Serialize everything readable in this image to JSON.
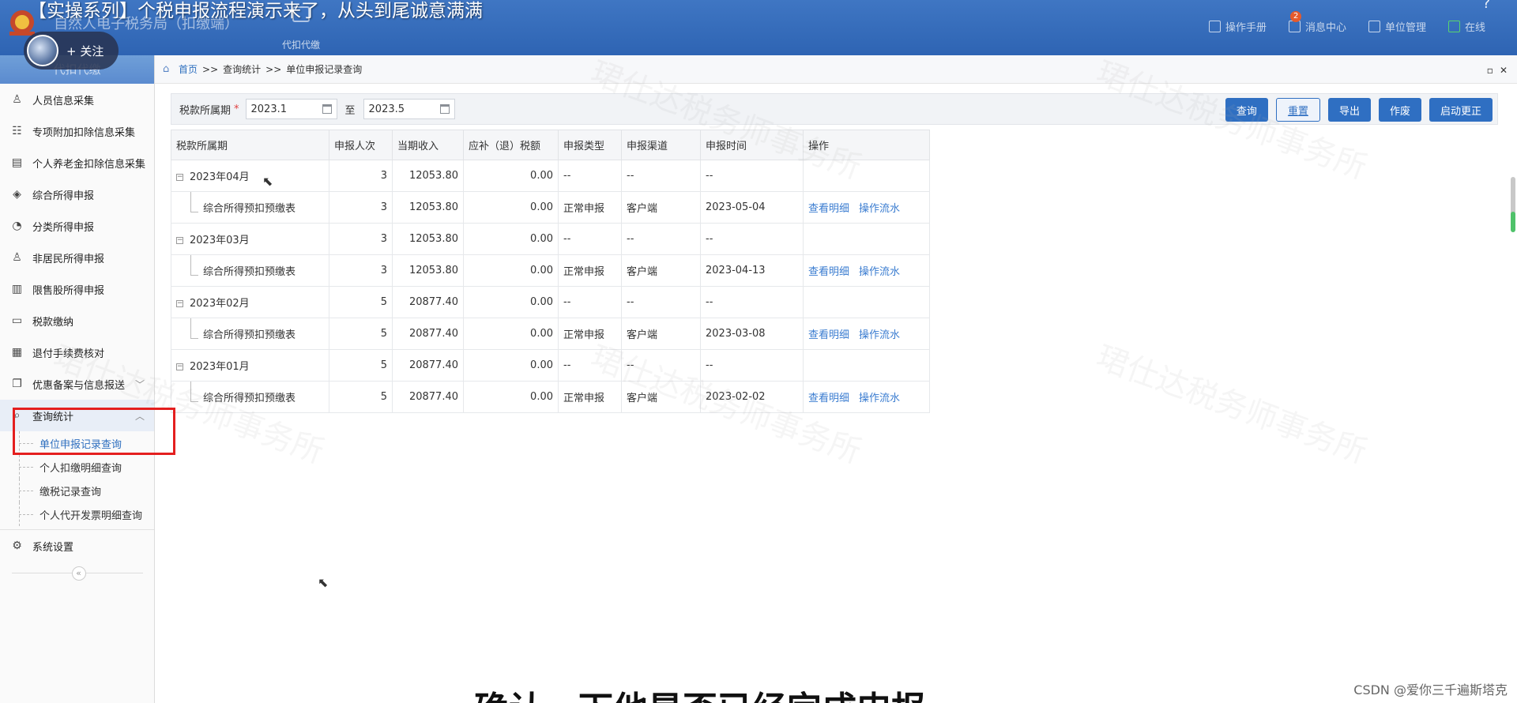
{
  "video": {
    "title": "【实操系列】个税申报流程演示来了，从头到尾诚意满满",
    "follow_label": "+ 关注",
    "subtitle": "确认一下他是否已经完成申报",
    "csdn_credit": "CSDN @爱你三千遍斯塔克"
  },
  "header": {
    "app_title": "自然人电子税务局（扣缴端）",
    "tab_label": "代扣代缴",
    "links": [
      {
        "label": "操作手册",
        "icon": "manual-icon"
      },
      {
        "label": "消息中心",
        "icon": "mail-icon",
        "badge": "2"
      },
      {
        "label": "单位管理",
        "icon": "building-icon"
      },
      {
        "label": "在线",
        "icon": "online-icon"
      }
    ],
    "help_symbol": "?"
  },
  "sidebar": {
    "head": "代扣代缴",
    "items": [
      {
        "label": "人员信息采集",
        "icon": "person-icon"
      },
      {
        "label": "专项附加扣除信息采集",
        "icon": "list-icon"
      },
      {
        "label": "个人养老金扣除信息采集",
        "icon": "doc-person-icon"
      },
      {
        "label": "综合所得申报",
        "icon": "layers-icon"
      },
      {
        "label": "分类所得申报",
        "icon": "pie-icon"
      },
      {
        "label": "非居民所得申报",
        "icon": "user-icon"
      },
      {
        "label": "限售股所得申报",
        "icon": "bar-chart-icon"
      },
      {
        "label": "税款缴纳",
        "icon": "wallet-icon"
      },
      {
        "label": "退付手续费核对",
        "icon": "receipt-icon"
      },
      {
        "label": "优惠备案与信息报送",
        "icon": "copy-icon"
      },
      {
        "label": "查询统计",
        "icon": "search-icon"
      },
      {
        "label": "系统设置",
        "icon": "gear-icon"
      }
    ],
    "subitems": [
      "单位申报记录查询",
      "个人扣缴明细查询",
      "缴税记录查询",
      "个人代开发票明细查询"
    ],
    "collapse_symbol": "«"
  },
  "breadcrumb": {
    "home": "首页",
    "sep": ">>",
    "level1": "查询统计",
    "level2": "单位申报记录查询",
    "ctrl_restore": "▫",
    "ctrl_close": "✕"
  },
  "filter": {
    "label": "税款所属期",
    "required_mark": "*",
    "from_value": "2023.1",
    "to_label": "至",
    "to_value": "2023.5",
    "buttons": {
      "query": "查询",
      "reset": "重置",
      "export": "导出",
      "void": "作废",
      "correct": "启动更正"
    }
  },
  "table": {
    "headers": [
      "税款所属期",
      "申报人次",
      "当期收入",
      "应补（退）税额",
      "申报类型",
      "申报渠道",
      "申报时间",
      "操作"
    ],
    "rows": [
      {
        "period": "2023年04月",
        "count": "3",
        "income": "12053.80",
        "tax": "0.00",
        "type": "--",
        "channel": "--",
        "time": "--",
        "view": "",
        "flow": ""
      },
      {
        "period": "综合所得预扣预缴表",
        "count": "3",
        "income": "12053.80",
        "tax": "0.00",
        "type": "正常申报",
        "channel": "客户端",
        "time": "2023-05-04",
        "view": "查看明细",
        "flow": "操作流水"
      },
      {
        "period": "2023年03月",
        "count": "3",
        "income": "12053.80",
        "tax": "0.00",
        "type": "--",
        "channel": "--",
        "time": "--",
        "view": "",
        "flow": ""
      },
      {
        "period": "综合所得预扣预缴表",
        "count": "3",
        "income": "12053.80",
        "tax": "0.00",
        "type": "正常申报",
        "channel": "客户端",
        "time": "2023-04-13",
        "view": "查看明细",
        "flow": "操作流水"
      },
      {
        "period": "2023年02月",
        "count": "5",
        "income": "20877.40",
        "tax": "0.00",
        "type": "--",
        "channel": "--",
        "time": "--",
        "view": "",
        "flow": ""
      },
      {
        "period": "综合所得预扣预缴表",
        "count": "5",
        "income": "20877.40",
        "tax": "0.00",
        "type": "正常申报",
        "channel": "客户端",
        "time": "2023-03-08",
        "view": "查看明细",
        "flow": "操作流水"
      },
      {
        "period": "2023年01月",
        "count": "5",
        "income": "20877.40",
        "tax": "0.00",
        "type": "--",
        "channel": "--",
        "time": "--",
        "view": "",
        "flow": ""
      },
      {
        "period": "综合所得预扣预缴表",
        "count": "5",
        "income": "20877.40",
        "tax": "0.00",
        "type": "正常申报",
        "channel": "客户端",
        "time": "2023-02-02",
        "view": "查看明细",
        "flow": "操作流水"
      }
    ],
    "toggle_symbol": "−"
  },
  "watermark": "珺仕达税务师事务所",
  "colors": {
    "header_blue": "#2e64b3",
    "accent": "#2f6fc2",
    "highlight_red": "#e41f1f"
  }
}
